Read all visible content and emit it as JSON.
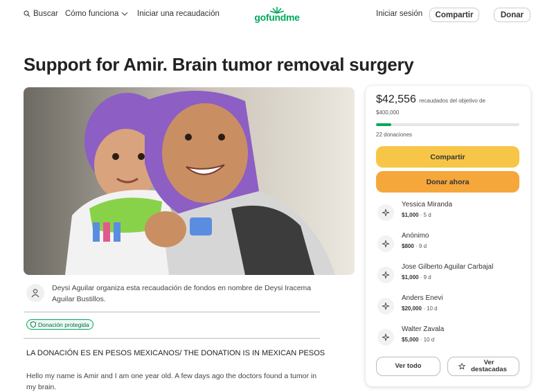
{
  "header": {
    "search_label": "Buscar",
    "how_it_works_label": "Cómo funciona",
    "start_label": "Iniciar una recaudación",
    "logo_text": "gofundme",
    "login_label": "Iniciar sesión",
    "share_label": "Compartir",
    "donate_label": "Donar"
  },
  "campaign": {
    "title": "Support for Amir. Brain tumor removal surgery",
    "organizer_text": "Deysi Aguilar organiza esta recaudación de fondos en nombre de Deysi Iracema Aguilar Bustillos.",
    "protected_badge": "Donación protegida",
    "story_title": "LA DONACIÓN ES EN PESOS MEXICANOS/ THE DONATION IS IN MEXICAN PESOS",
    "story_body": "Hello my name is Amir and I am one year old. A few days ago the doctors found a tumor in my brain."
  },
  "card": {
    "raised_amount": "$42,556",
    "raised_text": "recaudados del objetivo de",
    "goal_amount": "$400,000",
    "progress_fraction": 0.106,
    "donations_count": "22 donaciones",
    "share_label": "Compartir",
    "donate_now_label": "Donar ahora",
    "donations": [
      {
        "name": "Yessica Miranda",
        "amount": "$1,000",
        "time": "5 d"
      },
      {
        "name": "Anónimo",
        "amount": "$800",
        "time": "9 d"
      },
      {
        "name": "Jose Gilberto Aguilar Carbajal",
        "amount": "$1,000",
        "time": "9 d"
      },
      {
        "name": "Anders Enevi",
        "amount": "$20,000",
        "time": "10 d"
      },
      {
        "name": "Walter Zavala",
        "amount": "$5,000",
        "time": "10 d"
      }
    ],
    "see_all_label": "Ver todo",
    "see_top_label": "Ver destacadas"
  },
  "colors": {
    "brand_green": "#02a95c",
    "share_yellow": "#f7c648",
    "donate_orange": "#f5a73b"
  }
}
